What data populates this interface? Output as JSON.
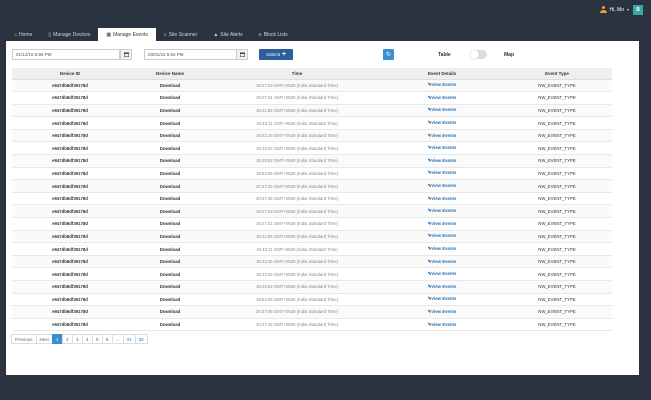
{
  "header": {
    "greeting": "Hi, Mo",
    "dropdown_glyph": "▾",
    "avatar_initial": "B",
    "avatar_color": "#3aa7a3"
  },
  "tabs": [
    {
      "label": "Home",
      "icon": "home-icon",
      "glyph": "⌂"
    },
    {
      "label": "Manage Devices",
      "icon": "device-icon",
      "glyph": "▯"
    },
    {
      "label": "Manage Events",
      "icon": "calendar-icon",
      "glyph": "▦"
    },
    {
      "label": "Site Scanner",
      "icon": "search-icon",
      "glyph": "⌕"
    },
    {
      "label": "Site Alerts",
      "icon": "bell-icon",
      "glyph": "▲"
    },
    {
      "label": "Block Lists",
      "icon": "list-icon",
      "glyph": "≡"
    }
  ],
  "active_tab": "Manage Events",
  "filters": {
    "start_value": "01/12/16 5:56 PM",
    "end_value": "03/01/16 5:56 PM",
    "submit_label": "Submit",
    "submit_glyph": "+",
    "refresh_glyph": "↻",
    "table_label": "Table",
    "map_label": "Map"
  },
  "table": {
    "columns": [
      "Device ID",
      "Device Name",
      "Time",
      "Event Details",
      "Event Type"
    ],
    "rows": [
      [
        "e947db8df39178d",
        "Download",
        "19:27:23 GMT+0530 (India Standard Time)",
        "View Events",
        "NW_EVENT_TYPE"
      ],
      [
        "e947db8df39178d",
        "Download",
        "19:27:41 GMT+0530 (India Standard Time)",
        "View Events",
        "NW_EVENT_TYPE"
      ],
      [
        "e947db8df39178d",
        "Download",
        "19:42:55 GMT+0530 (India Standard Time)",
        "View Events",
        "NW_EVENT_TYPE"
      ],
      [
        "e947db8df39178d",
        "Download",
        "19:43:11 GMT+0530 (India Standard Time)",
        "View Events",
        "NW_EVENT_TYPE"
      ],
      [
        "e947db8df39178d",
        "Download",
        "19:43:16 GMT+0530 (India Standard Time)",
        "View Events",
        "NW_EVENT_TYPE"
      ],
      [
        "e947db8df39178d",
        "Download",
        "19:43:32 GMT+0530 (India Standard Time)",
        "View Events",
        "NW_EVENT_TYPE"
      ],
      [
        "e947db8df39178d",
        "Download",
        "19:49:52 GMT+0530 (India Standard Time)",
        "View Events",
        "NW_EVENT_TYPE"
      ],
      [
        "e947db8df39178d",
        "Download",
        "19:54:06 GMT+0530 (India Standard Time)",
        "View Events",
        "NW_EVENT_TYPE"
      ],
      [
        "e947db8df39178d",
        "Download",
        "20:47:45 GMT+0530 (India Standard Time)",
        "View Events",
        "NW_EVENT_TYPE"
      ],
      [
        "e947db8df39178d",
        "Download",
        "20:47:45 GMT+0530 (India Standard Time)",
        "View Events",
        "NW_EVENT_TYPE"
      ],
      [
        "e947db8df39178d",
        "Download",
        "19:27:23 GMT+0530 (India Standard Time)",
        "View Events",
        "NW_EVENT_TYPE"
      ],
      [
        "e947db8df39178d",
        "Download",
        "19:27:41 GMT+0530 (India Standard Time)",
        "View Events",
        "NW_EVENT_TYPE"
      ],
      [
        "e947db8df39178d",
        "Download",
        "19:42:55 GMT+0530 (India Standard Time)",
        "View Events",
        "NW_EVENT_TYPE"
      ],
      [
        "e947db8df39178d",
        "Download",
        "19:43:11 GMT+0530 (India Standard Time)",
        "View Events",
        "NW_EVENT_TYPE"
      ],
      [
        "e947db8df39178d",
        "Download",
        "19:43:16 GMT+0530 (India Standard Time)",
        "View Events",
        "NW_EVENT_TYPE"
      ],
      [
        "e947db8df39178d",
        "Download",
        "19:43:32 GMT+0530 (India Standard Time)",
        "View Events",
        "NW_EVENT_TYPE"
      ],
      [
        "e947db8df39178d",
        "Download",
        "19:49:52 GMT+0530 (India Standard Time)",
        "View Events",
        "NW_EVENT_TYPE"
      ],
      [
        "e947db8df39178d",
        "Download",
        "19:54:06 GMT+0530 (India Standard Time)",
        "View Events",
        "NW_EVENT_TYPE"
      ],
      [
        "e947db8df39178d",
        "Download",
        "20:47:45 GMT+0530 (India Standard Time)",
        "View Events",
        "NW_EVENT_TYPE"
      ],
      [
        "e947db8df39178d",
        "Download",
        "20:47:45 GMT+0530 (India Standard Time)",
        "View Events",
        "NW_EVENT_TYPE"
      ]
    ]
  },
  "pagination": {
    "items": [
      "Previous",
      "Next",
      "1",
      "2",
      "3",
      "4",
      "5",
      "6",
      "...",
      "31",
      "32"
    ],
    "active": "1"
  },
  "colors": {
    "background": "#2b3340",
    "accent": "#3a8fd0",
    "submit": "#2d5e9c",
    "link": "#2a6fb5"
  }
}
